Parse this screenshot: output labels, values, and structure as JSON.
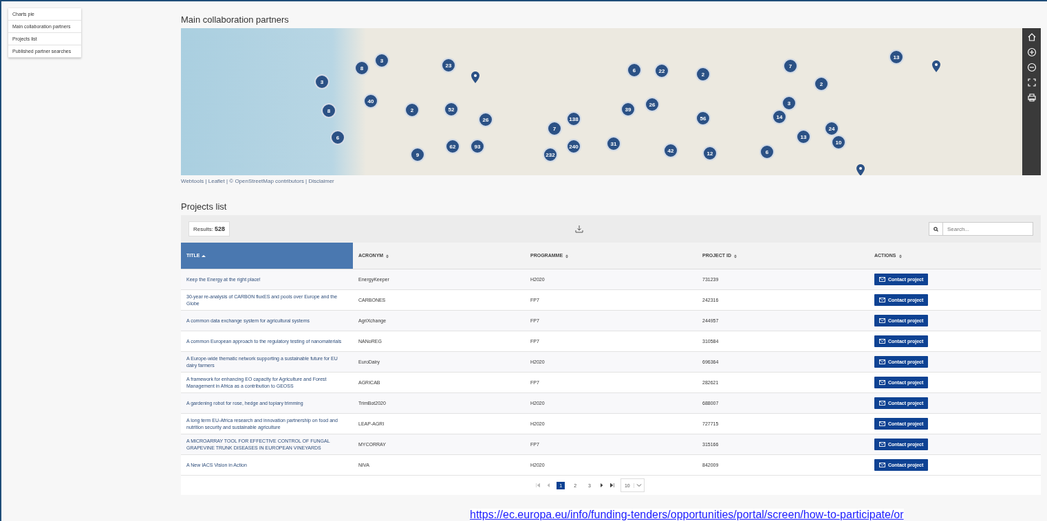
{
  "sidebar": {
    "items": [
      {
        "label": "Charts pie"
      },
      {
        "label": "Main collaboration partners"
      },
      {
        "label": "Projects list"
      },
      {
        "label": "Published partner searches"
      }
    ]
  },
  "map_section": {
    "title": "Main collaboration partners",
    "clusters": [
      {
        "count": "3"
      },
      {
        "count": "8"
      },
      {
        "count": "6"
      },
      {
        "count": "8"
      },
      {
        "count": "40"
      },
      {
        "count": "3"
      },
      {
        "count": "2"
      },
      {
        "count": "9"
      },
      {
        "count": "23"
      },
      {
        "count": "52"
      },
      {
        "count": "62"
      },
      {
        "count": "93"
      },
      {
        "count": "26"
      },
      {
        "count": "232"
      },
      {
        "count": "7"
      },
      {
        "count": "138"
      },
      {
        "count": "240"
      },
      {
        "count": "31"
      },
      {
        "count": "39"
      },
      {
        "count": "6"
      },
      {
        "count": "26"
      },
      {
        "count": "22"
      },
      {
        "count": "42"
      },
      {
        "count": "2"
      },
      {
        "count": "56"
      },
      {
        "count": "12"
      },
      {
        "count": "6"
      },
      {
        "count": "14"
      },
      {
        "count": "3"
      },
      {
        "count": "7"
      },
      {
        "count": "13"
      },
      {
        "count": "2"
      },
      {
        "count": "24"
      },
      {
        "count": "10"
      },
      {
        "count": "13"
      }
    ],
    "attribution": "Webtools | Leaflet | © OpenStreetMap contributors | Disclaimer"
  },
  "projects_section": {
    "title": "Projects list",
    "results_label": "Results:",
    "results_count": "528",
    "search": {
      "placeholder": "Search..."
    },
    "columns": [
      {
        "label": "TITLE",
        "selected": true
      },
      {
        "label": "ACRONYM",
        "selected": false
      },
      {
        "label": "PROGRAMME",
        "selected": false
      },
      {
        "label": "PROJECT ID",
        "selected": false
      },
      {
        "label": "ACTIONS",
        "selected": false
      }
    ],
    "rows": [
      {
        "title": "Keep the Energy at the right place!",
        "acronym": "EnergyKeeper",
        "programme": "H2020",
        "project_id": "731239",
        "action": "Contact project"
      },
      {
        "title": "30-year re-analysis of CARBON fluxES and pools over Europe and the Globe",
        "acronym": "CARBONES",
        "programme": "FP7",
        "project_id": "242316",
        "action": "Contact project"
      },
      {
        "title": "A common data exchange system for agricultural systems",
        "acronym": "AgriXchange",
        "programme": "FP7",
        "project_id": "244957",
        "action": "Contact project"
      },
      {
        "title": "A common European approach to the regulatory testing of nanomaterials",
        "acronym": "NANoREG",
        "programme": "FP7",
        "project_id": "310584",
        "action": "Contact project"
      },
      {
        "title": "A Europe-wide thematic network supporting a sustainable future for EU dairy farmers",
        "acronym": "EuroDairy",
        "programme": "H2020",
        "project_id": "696364",
        "action": "Contact project"
      },
      {
        "title": "A framework for enhancing EO capacity for Agriculture and Forest Management in Africa as a contribution to GEOSS",
        "acronym": "AGRICAB",
        "programme": "FP7",
        "project_id": "282621",
        "action": "Contact project"
      },
      {
        "title": "A gardening robot for rose, hedge and topiary trimming",
        "acronym": "TrimBot2020",
        "programme": "H2020",
        "project_id": "688007",
        "action": "Contact project"
      },
      {
        "title": "A long term EU-Africa research and innovation partnership on food and nutrition security and sustainable agriculture",
        "acronym": "LEAP-AGRI",
        "programme": "H2020",
        "project_id": "727715",
        "action": "Contact project"
      },
      {
        "title": "A MICROARRAY TOOL FOR EFFECTIVE CONTROL OF FUNGAL GRAPEVINE TRUNK DISEASES IN EUROPEAN VINEYARDS",
        "acronym": "MYCORRAY",
        "programme": "FP7",
        "project_id": "315166",
        "action": "Contact project"
      },
      {
        "title": "A New IACS Vision in Action",
        "acronym": "NIVA",
        "programme": "H2020",
        "project_id": "842009",
        "action": "Contact project"
      }
    ],
    "pagination": {
      "pages": [
        {
          "label": "1",
          "selected": true
        },
        {
          "label": "2",
          "selected": false
        },
        {
          "label": "3",
          "selected": false
        }
      ],
      "page_size": "10"
    }
  },
  "source_url": "https://ec.europa.eu/info/funding-tenders/opportunities/portal/screen/how-to-participate/or"
}
